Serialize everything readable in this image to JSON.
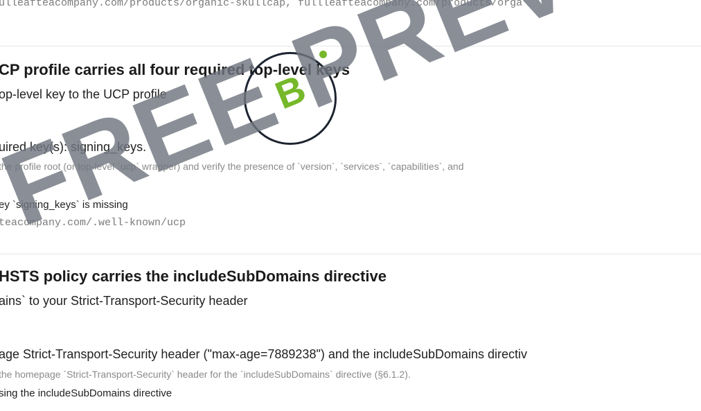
{
  "urls_line": "ulleafteacompany.com/products/organic-skullcap, fullleafteacompany.com/products/orga",
  "checks": [
    {
      "title": "CP profile carries all four required top-level keys",
      "fix": "op-level key to the UCP profile",
      "result": "uired key(s): signing_keys.",
      "method": "the profile root (or top-level `ucp` wrapper) and verify the presence of `version`, `services`, `capabilities`, and",
      "evidence": "ey `signing_keys` is missing",
      "url": "teacompany.com/.well-known/ucp"
    },
    {
      "title": "HSTS policy carries the includeSubDomains directive",
      "fix": "ains` to your Strict-Transport-Security header",
      "result": "age Strict-Transport-Security header (\"max-age=7889238\") and the includeSubDomains directiv",
      "method": "the homepage `Strict-Transport-Security` header for the `includeSubDomains` directive (§6.1.2).",
      "evidence": "sing the includeSubDomains directive"
    }
  ],
  "badge": {
    "letter": "B"
  },
  "watermark": "FREE PREVIEW"
}
